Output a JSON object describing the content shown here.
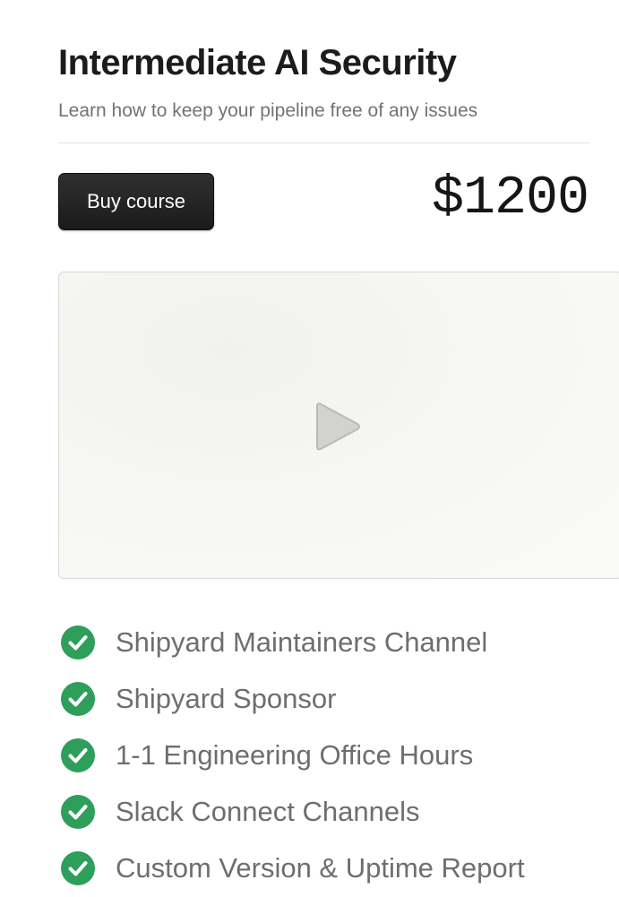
{
  "course": {
    "title": "Intermediate AI Security",
    "subtitle": "Learn how to keep your pipeline free of any issues",
    "buy_label": "Buy course",
    "price": "$1200"
  },
  "video": {
    "play_icon": "play-icon"
  },
  "features": {
    "check_color": "#2e9e5b",
    "items": [
      {
        "label": "Shipyard Maintainers Channel",
        "icon": "check-circle-icon"
      },
      {
        "label": "Shipyard Sponsor",
        "icon": "check-circle-icon"
      },
      {
        "label": "1-1 Engineering Office Hours",
        "icon": "check-circle-icon"
      },
      {
        "label": "Slack Connect Channels",
        "icon": "check-circle-icon"
      },
      {
        "label": "Custom Version & Uptime Report",
        "icon": "check-circle-icon"
      }
    ]
  }
}
